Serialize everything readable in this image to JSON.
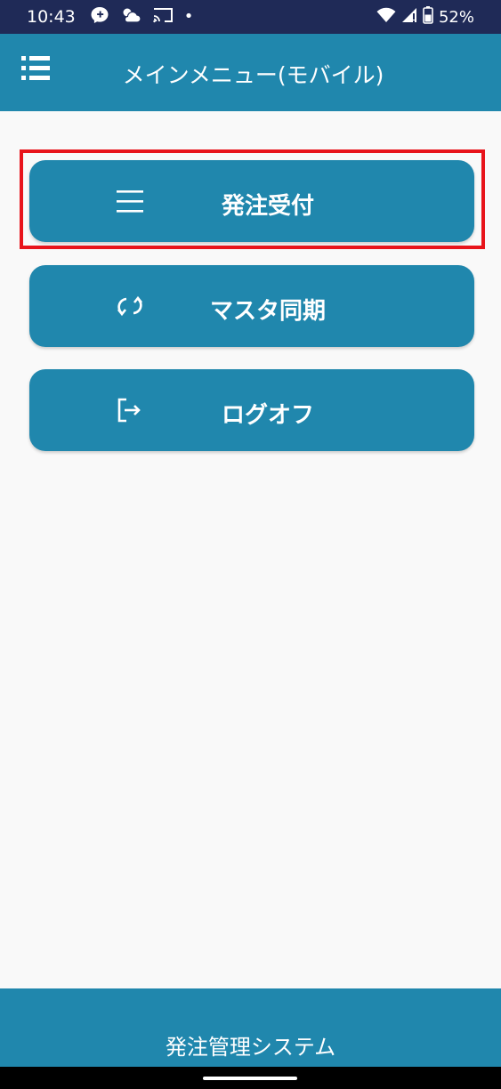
{
  "status_bar": {
    "time": "10:43",
    "dot": "•",
    "battery": "52%",
    "icons": [
      "messenger-icon",
      "weather-icon",
      "cast-icon",
      "wifi-icon",
      "signal-icon",
      "battery-icon"
    ]
  },
  "app_bar": {
    "title": "メインメニュー(モバイル)",
    "menu_icon": "list-menu-icon"
  },
  "menu": {
    "items": [
      {
        "label": "発注受付",
        "icon": "lines-icon",
        "selected": true
      },
      {
        "label": "マスタ同期",
        "icon": "sync-icon",
        "selected": false
      },
      {
        "label": "ログオフ",
        "icon": "logout-icon",
        "selected": false
      }
    ]
  },
  "footer": {
    "title": "発注管理システム"
  },
  "colors": {
    "status_bar": "#1f2a57",
    "primary": "#2087ad",
    "background": "#f9f9f9",
    "highlight": "#e8141b"
  }
}
